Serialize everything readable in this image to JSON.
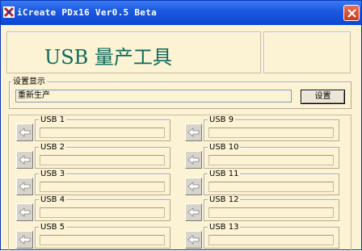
{
  "window": {
    "title": "iCreate PDx16 Ver0.5 Beta",
    "icons": {
      "app": "app-logo-icon",
      "close": "close-icon"
    }
  },
  "header": {
    "title": "USB 量产工具"
  },
  "settings": {
    "group_label": "设置显示",
    "mode_value": "重新生产",
    "button_label": "设置"
  },
  "slots_left": [
    {
      "label": "USB 1",
      "status": ""
    },
    {
      "label": "USB 2",
      "status": ""
    },
    {
      "label": "USB 3",
      "status": ""
    },
    {
      "label": "USB 4",
      "status": ""
    },
    {
      "label": "USB 5",
      "status": ""
    }
  ],
  "slots_right": [
    {
      "label": "USB 9",
      "status": ""
    },
    {
      "label": "USB 10",
      "status": ""
    },
    {
      "label": "USB 11",
      "status": ""
    },
    {
      "label": "USB 12",
      "status": ""
    },
    {
      "label": "USB 13",
      "status": ""
    }
  ],
  "colors": {
    "window_bg": "#fcf2d4",
    "titlebar": "#0a46d0",
    "header_title": "#0c6a5c",
    "close_button": "#c8391d"
  }
}
